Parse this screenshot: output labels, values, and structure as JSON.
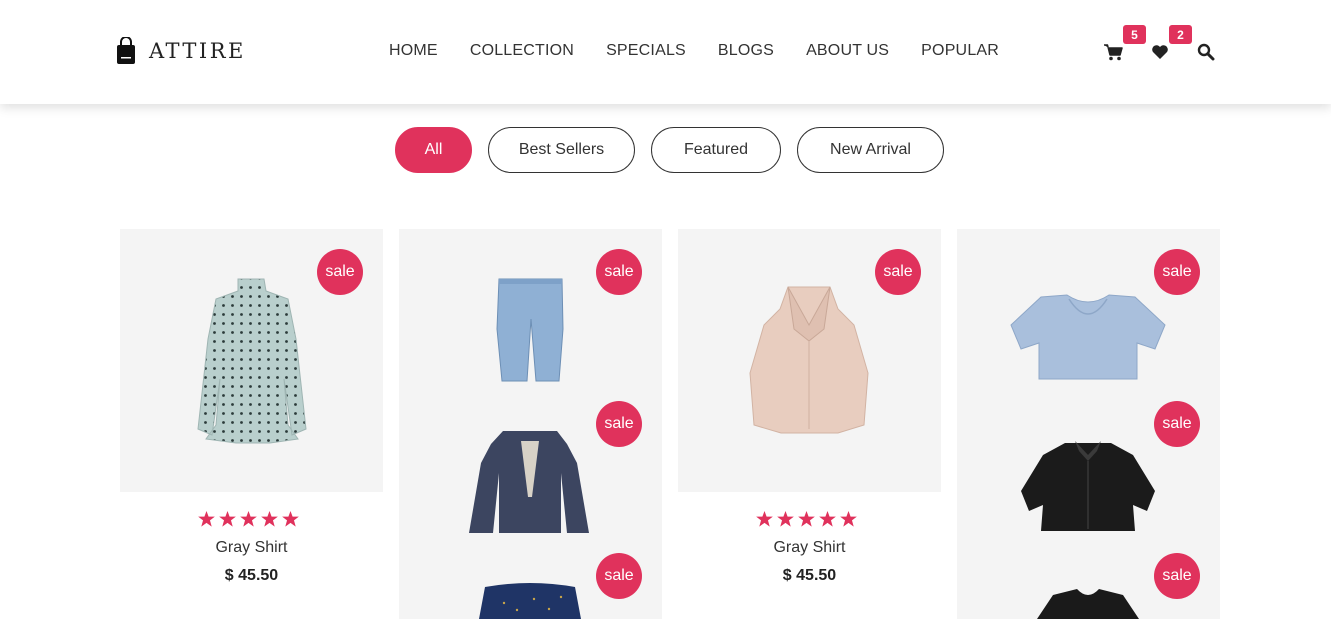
{
  "brand": {
    "name": "ATTIRE",
    "icon": "shopping-bag-icon"
  },
  "nav": [
    "HOME",
    "COLLECTION",
    "SPECIALS",
    "BLOGS",
    "ABOUT US",
    "POPULAR"
  ],
  "header_icons": {
    "cart": {
      "icon": "cart-icon",
      "count": "5"
    },
    "wishlist": {
      "icon": "heart-icon",
      "count": "2"
    },
    "search": {
      "icon": "search-icon"
    }
  },
  "filters": [
    {
      "label": "All",
      "active": true
    },
    {
      "label": "Best Sellers",
      "active": false
    },
    {
      "label": "Featured",
      "active": false
    },
    {
      "label": "New Arrival",
      "active": false
    }
  ],
  "sale_label": "sale",
  "products": [
    {
      "name": "Gray Shirt",
      "price": "$ 45.50",
      "rating": 5,
      "image": "polka-dot-blouse"
    },
    {
      "name": "Gray Shirt",
      "price": "$ 45.50",
      "rating": 5,
      "image": "sleeveless-collar-top"
    }
  ],
  "stacked_items": [
    {
      "image": "jeans"
    },
    {
      "image": "denim-jacket"
    },
    {
      "image": "navy-dotted-top"
    },
    {
      "image": "blue-crop-top"
    },
    {
      "image": "black-shirt"
    },
    {
      "image": "black-top"
    }
  ],
  "colors": {
    "accent": "#e0325c",
    "card_bg": "#f4f4f4"
  }
}
